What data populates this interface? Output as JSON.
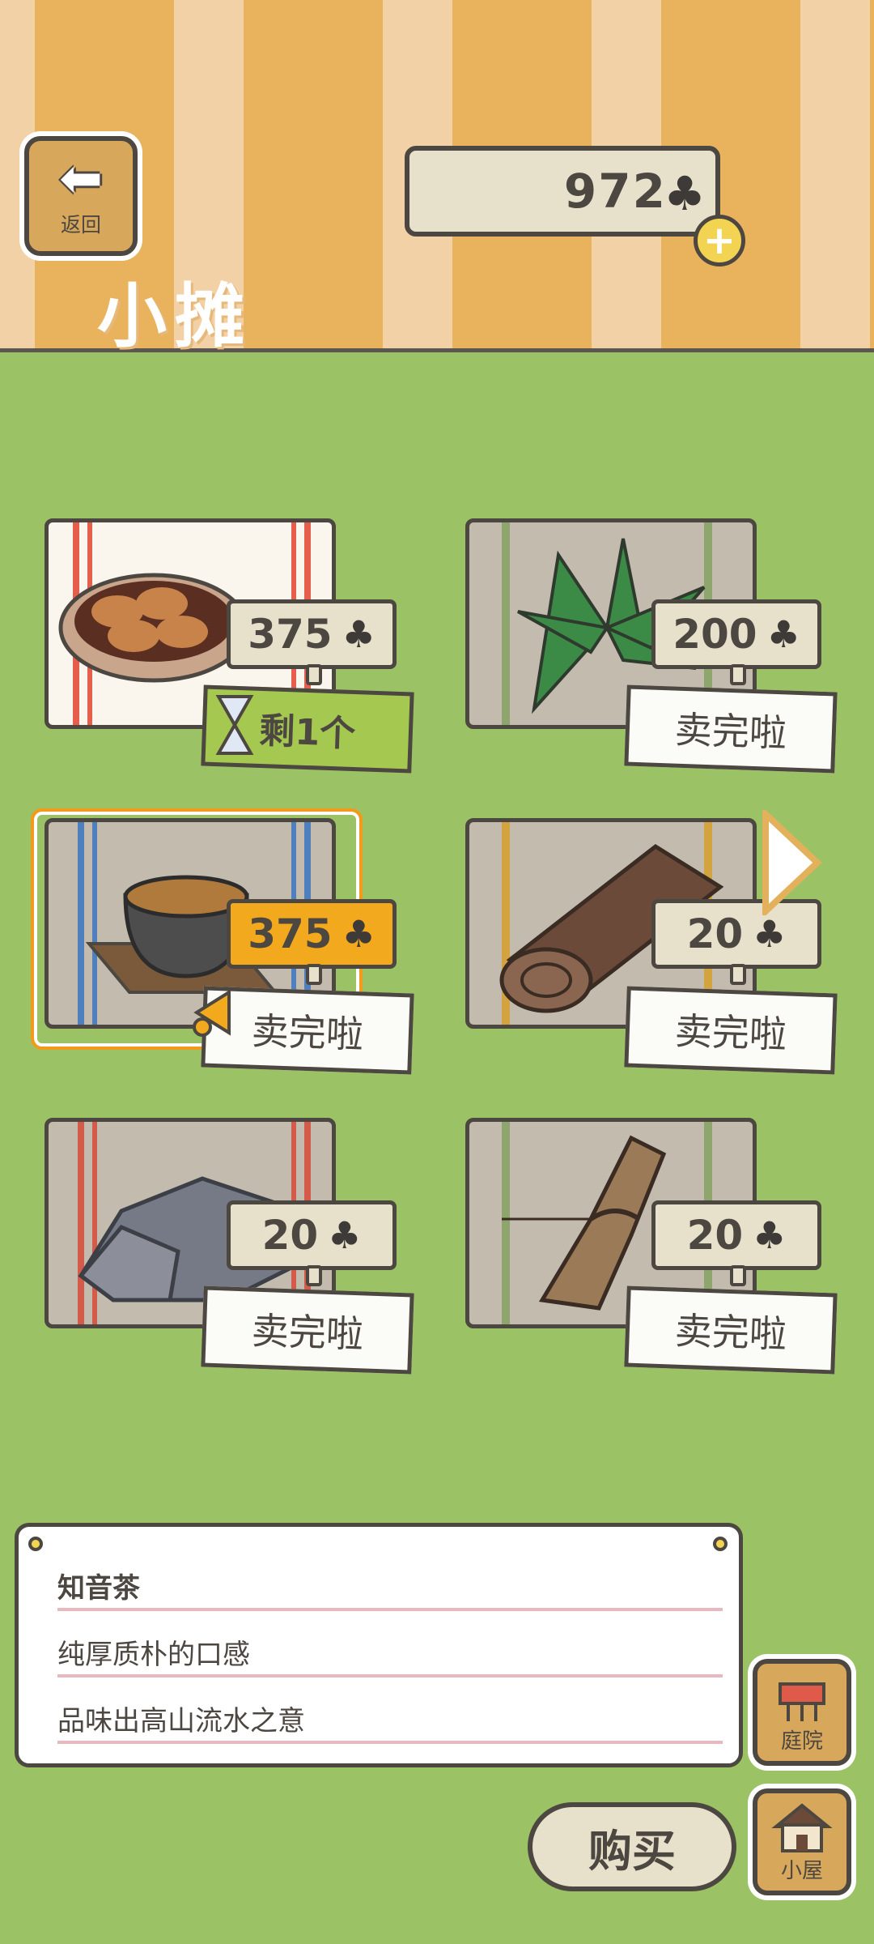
{
  "header": {
    "back_label": "返回",
    "title": "小摊",
    "currency": "972",
    "currency_icon": "clover-icon"
  },
  "items": [
    {
      "name": "dumplings",
      "price": "375",
      "status": "剩1个",
      "status_type": "remaining"
    },
    {
      "name": "bamboo-leaves",
      "price": "200",
      "status": "卖完啦",
      "status_type": "sold"
    },
    {
      "name": "tea-bowl",
      "price": "375",
      "status": "卖完啦",
      "status_type": "sold",
      "selected": true
    },
    {
      "name": "log",
      "price": "20",
      "status": "卖完啦",
      "status_type": "sold"
    },
    {
      "name": "stone",
      "price": "20",
      "status": "卖完啦",
      "status_type": "sold"
    },
    {
      "name": "bundle",
      "price": "20",
      "status": "卖完啦",
      "status_type": "sold"
    }
  ],
  "description": {
    "title": "知音茶",
    "line1": "纯厚质朴的口感",
    "line2": "品味出高山流水之意"
  },
  "buttons": {
    "courtyard": "庭院",
    "house": "小屋",
    "buy": "购买"
  },
  "colors": {
    "grass": "#9bc365",
    "selected_price": "#f3a91e",
    "remaining_tag": "#a5c850"
  }
}
